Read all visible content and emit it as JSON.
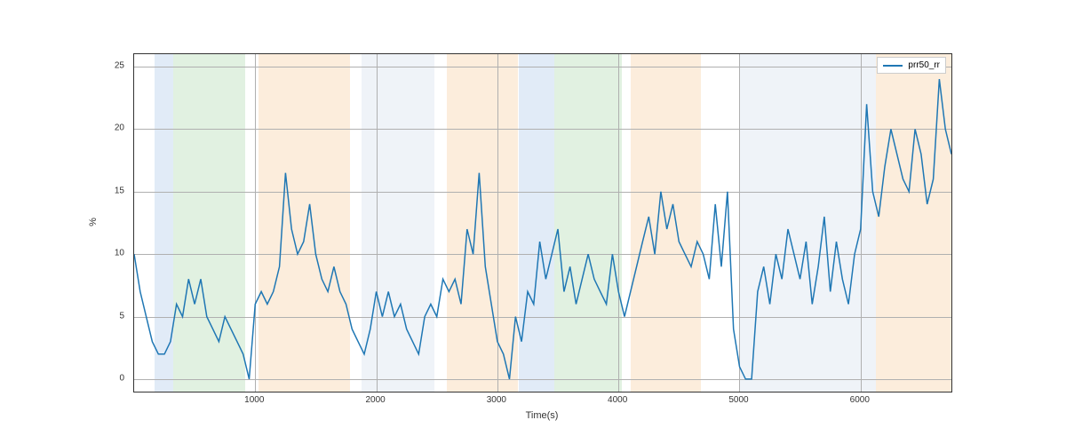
{
  "chart_data": {
    "type": "line",
    "title": "",
    "xlabel": "Time(s)",
    "ylabel": "%",
    "xlim": [
      0,
      6750
    ],
    "ylim": [
      -1,
      26
    ],
    "xticks": [
      1000,
      2000,
      3000,
      4000,
      5000,
      6000
    ],
    "yticks": [
      0,
      5,
      10,
      15,
      20,
      25
    ],
    "legend_position": "upper right",
    "bands": [
      {
        "start": 170,
        "end": 320,
        "color": "blue"
      },
      {
        "start": 320,
        "end": 920,
        "color": "green"
      },
      {
        "start": 1030,
        "end": 1780,
        "color": "orange"
      },
      {
        "start": 1880,
        "end": 2480,
        "color": "lightblue"
      },
      {
        "start": 2580,
        "end": 3170,
        "color": "orange"
      },
      {
        "start": 3180,
        "end": 3470,
        "color": "blue"
      },
      {
        "start": 3470,
        "end": 4030,
        "color": "green"
      },
      {
        "start": 4100,
        "end": 4680,
        "color": "orange"
      },
      {
        "start": 5000,
        "end": 6130,
        "color": "lightblue"
      },
      {
        "start": 6130,
        "end": 6750,
        "color": "orange"
      }
    ],
    "series": [
      {
        "name": "prr50_rr",
        "color": "#1f77b4",
        "x": [
          0,
          50,
          100,
          150,
          200,
          250,
          300,
          350,
          400,
          450,
          500,
          550,
          600,
          650,
          700,
          750,
          800,
          850,
          900,
          950,
          1000,
          1050,
          1100,
          1150,
          1200,
          1250,
          1300,
          1350,
          1400,
          1450,
          1500,
          1550,
          1600,
          1650,
          1700,
          1750,
          1800,
          1850,
          1900,
          1950,
          2000,
          2050,
          2100,
          2150,
          2200,
          2250,
          2300,
          2350,
          2400,
          2450,
          2500,
          2550,
          2600,
          2650,
          2700,
          2750,
          2800,
          2850,
          2900,
          2950,
          3000,
          3050,
          3100,
          3150,
          3200,
          3250,
          3300,
          3350,
          3400,
          3450,
          3500,
          3550,
          3600,
          3650,
          3700,
          3750,
          3800,
          3850,
          3900,
          3950,
          4000,
          4050,
          4100,
          4150,
          4200,
          4250,
          4300,
          4350,
          4400,
          4450,
          4500,
          4550,
          4600,
          4650,
          4700,
          4750,
          4800,
          4850,
          4900,
          4950,
          5000,
          5050,
          5100,
          5150,
          5200,
          5250,
          5300,
          5350,
          5400,
          5450,
          5500,
          5550,
          5600,
          5650,
          5700,
          5750,
          5800,
          5850,
          5900,
          5950,
          6000,
          6050,
          6100,
          6150,
          6200,
          6250,
          6300,
          6350,
          6400,
          6450,
          6500,
          6550,
          6600,
          6650,
          6700,
          6750
        ],
        "y": [
          10,
          7,
          5,
          3,
          2,
          2,
          3,
          6,
          5,
          8,
          6,
          8,
          5,
          4,
          3,
          5,
          4,
          3,
          2,
          0,
          6,
          7,
          6,
          7,
          9,
          16.5,
          12,
          10,
          11,
          14,
          10,
          8,
          7,
          9,
          7,
          6,
          4,
          3,
          2,
          4,
          7,
          5,
          7,
          5,
          6,
          4,
          3,
          2,
          5,
          6,
          5,
          8,
          7,
          8,
          6,
          12,
          10,
          16.5,
          9,
          6,
          3,
          2,
          0,
          5,
          3,
          7,
          6,
          11,
          8,
          10,
          12,
          7,
          9,
          6,
          8,
          10,
          8,
          7,
          6,
          10,
          7,
          5,
          7,
          9,
          11,
          13,
          10,
          15,
          12,
          14,
          11,
          10,
          9,
          11,
          10,
          8,
          14,
          9,
          15,
          4,
          1,
          0,
          0,
          7,
          9,
          6,
          10,
          8,
          12,
          10,
          8,
          11,
          6,
          9,
          13,
          7,
          11,
          8,
          6,
          10,
          12,
          22,
          15,
          13,
          17,
          20,
          18,
          16,
          15,
          20,
          18,
          14,
          16,
          24,
          20,
          18
        ]
      }
    ]
  },
  "legend": {
    "label": "prr50_rr"
  },
  "axes": {
    "xlabel": "Time(s)",
    "ylabel": "%"
  }
}
